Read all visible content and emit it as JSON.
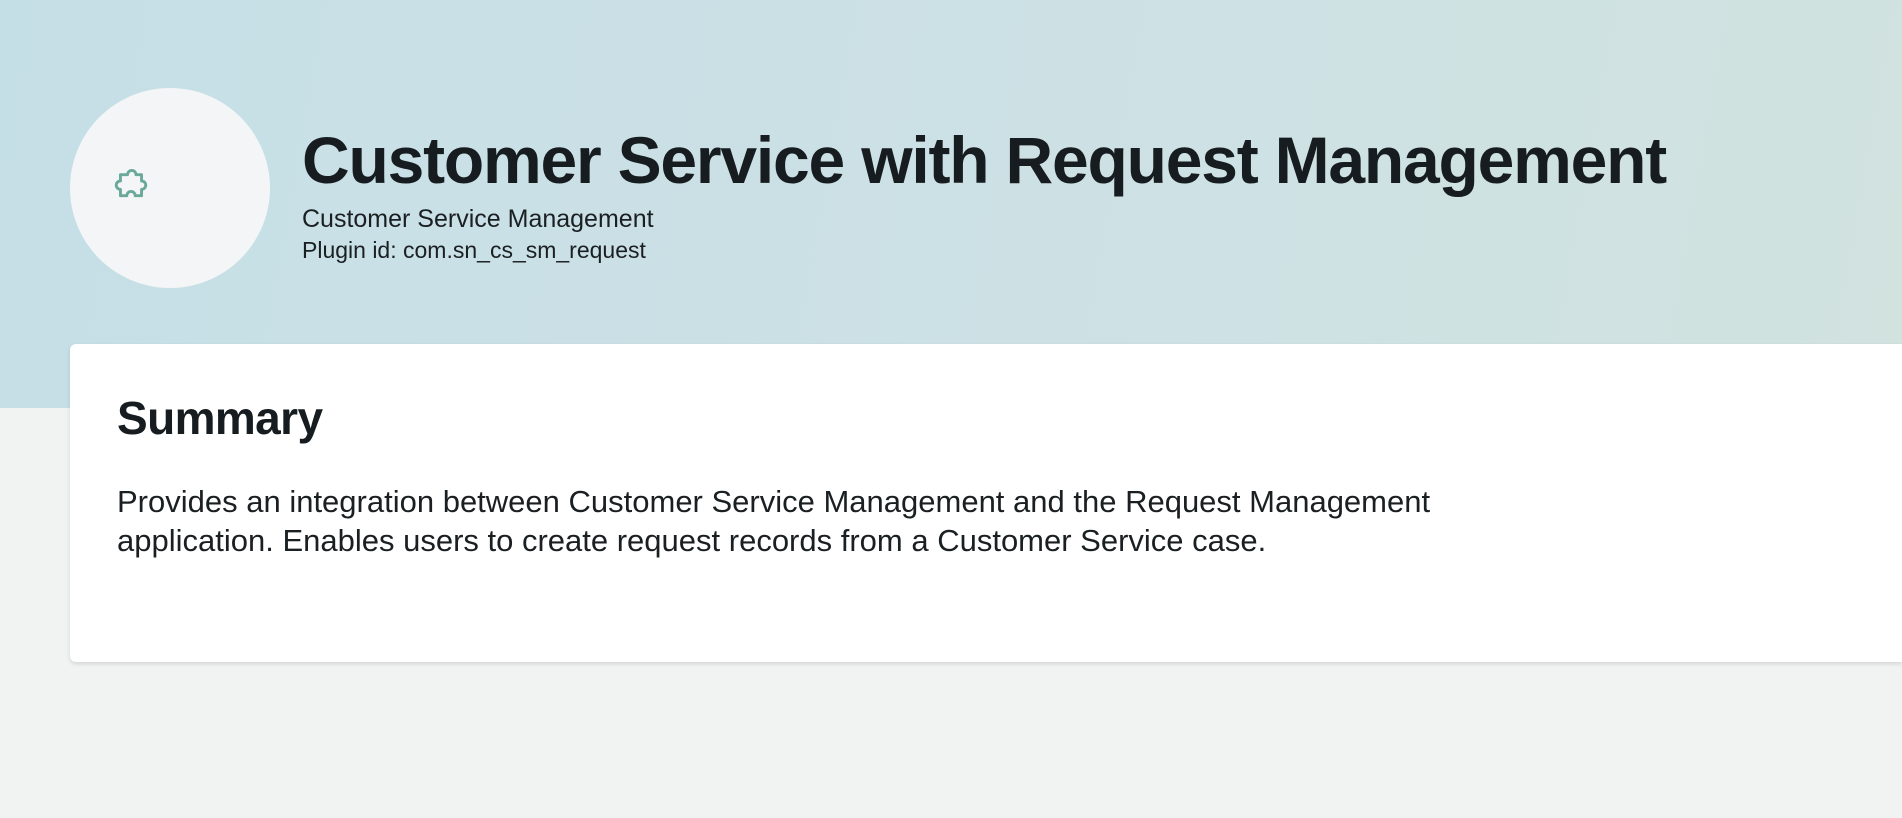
{
  "header": {
    "title": "Customer Service with Request Management",
    "product": "Customer Service Management",
    "plugin_id_label": "Plugin id:",
    "plugin_id": "com.sn_cs_sm_request",
    "icon": "puzzle-piece-icon"
  },
  "summary": {
    "heading": "Summary",
    "body": "Provides an integration between Customer Service Management and the Request Management application. Enables users to create request records from a Customer Service case."
  },
  "colors": {
    "hero_background": "#c8dfe5",
    "page_background": "#f1f3f2",
    "card_background": "#ffffff",
    "icon_accent": "#6aa99a",
    "text": "#1a1f22"
  }
}
